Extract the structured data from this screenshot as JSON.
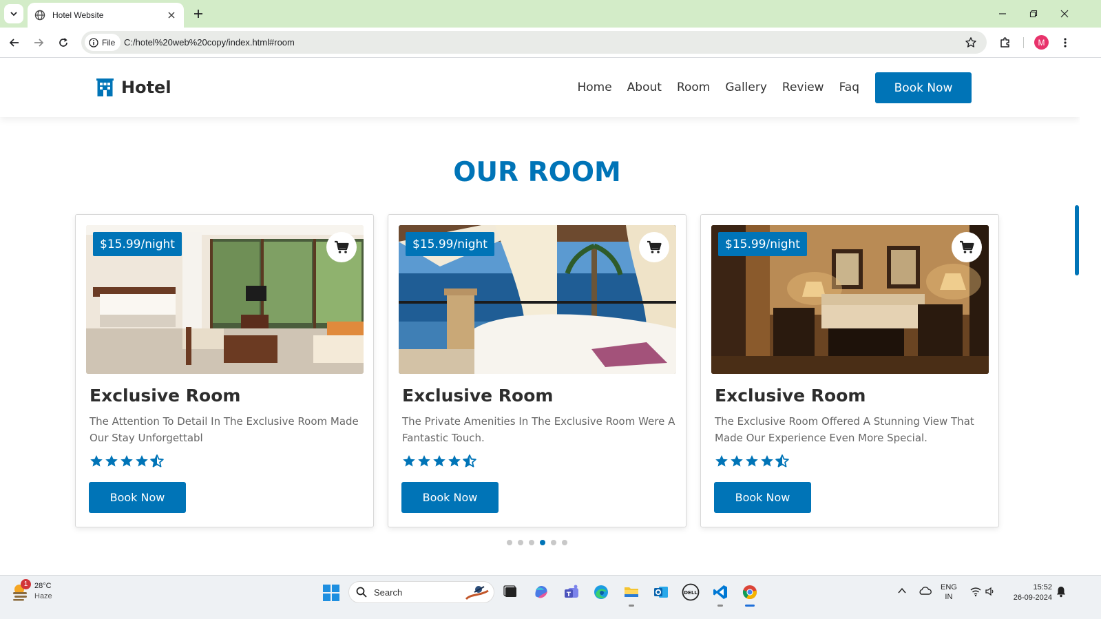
{
  "browser": {
    "tab_title": "Hotel Website",
    "site_chip": "File",
    "url": "C:/hotel%20web%20copy/index.html#room",
    "profile_initial": "M"
  },
  "header": {
    "logo_text": "Hotel",
    "nav": [
      "Home",
      "About",
      "Room",
      "Gallery",
      "Review",
      "Faq"
    ],
    "book_label": "Book Now"
  },
  "section": {
    "title": "OUR ROOM"
  },
  "rooms": [
    {
      "price": "$15.99/night",
      "title": "Exclusive Room",
      "description": "The Attention To Detail In The Exclusive Room Made Our Stay Unforgettabl",
      "rating": 4.5,
      "book_label": "Book Now"
    },
    {
      "price": "$15.99/night",
      "title": "Exclusive Room",
      "description": "The Private Amenities In The Exclusive Room Were A Fantastic Touch.",
      "rating": 4.5,
      "book_label": "Book Now"
    },
    {
      "price": "$15.99/night",
      "title": "Exclusive Room",
      "description": "The Exclusive Room Offered A Stunning View That Made Our Experience Even More Special.",
      "rating": 4.5,
      "book_label": "Book Now"
    }
  ],
  "carousel": {
    "dot_count": 6,
    "active_index": 3
  },
  "taskbar": {
    "weather_temp": "28°C",
    "weather_condition": "Haze",
    "weather_badge": "1",
    "search_label": "Search",
    "lang_line1": "ENG",
    "lang_line2": "IN",
    "time": "15:52",
    "date": "26-09-2024"
  },
  "colors": {
    "accent": "#0074b7",
    "tabbar": "#d3ecc8"
  }
}
